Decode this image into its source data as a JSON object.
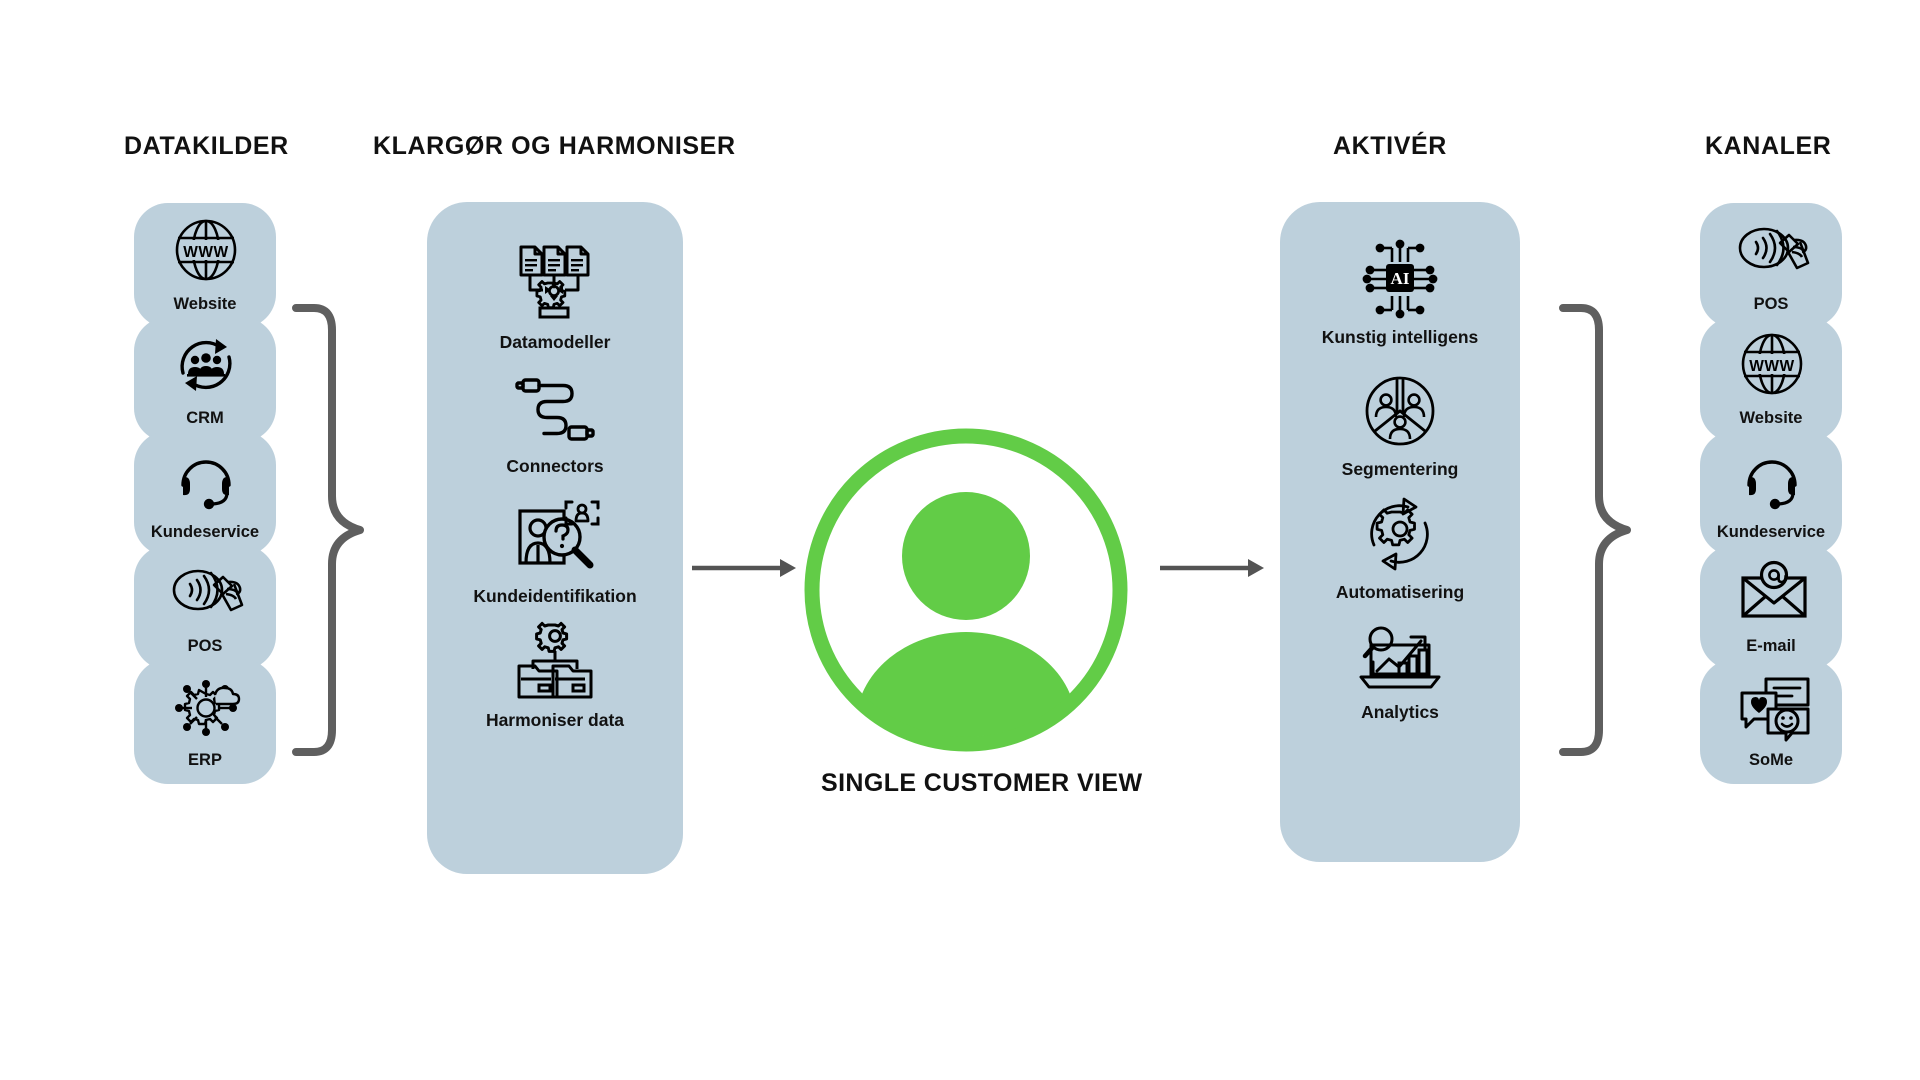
{
  "diagram": {
    "title": "SINGLE CUSTOMER VIEW",
    "colors": {
      "panel": "#bdd0dc",
      "accent_green": "#62cc47",
      "brace": "#5f5f5f",
      "arrow": "#545454",
      "text": "#111111"
    }
  },
  "columns": {
    "datakilder": {
      "header": "DATAKILDER",
      "items": [
        {
          "label": "Website",
          "icon": "globe-www-icon"
        },
        {
          "label": "CRM",
          "icon": "crm-people-cycle-icon"
        },
        {
          "label": "Kundeservice",
          "icon": "headset-icon"
        },
        {
          "label": "POS",
          "icon": "contactless-payment-icon"
        },
        {
          "label": "ERP",
          "icon": "erp-gear-network-cloud-icon"
        }
      ]
    },
    "klargor": {
      "header": "KLARGØR OG HARMONISER",
      "items": [
        {
          "label": "Datamodeller",
          "icon": "documents-to-gear-icon"
        },
        {
          "label": "Connectors",
          "icon": "cable-connector-icon"
        },
        {
          "label": "Kundeidentifikation",
          "icon": "person-magnifier-question-icon"
        },
        {
          "label": "Harmoniser data",
          "icon": "gear-two-folders-icon"
        }
      ]
    },
    "aktiver": {
      "header": "AKTIVÉR",
      "items": [
        {
          "label": "Kunstig intelligens",
          "icon": "ai-chip-icon"
        },
        {
          "label": "Segmentering",
          "icon": "segmented-pie-people-icon"
        },
        {
          "label": "Automatisering",
          "icon": "gear-refresh-cycle-icon"
        },
        {
          "label": "Analytics",
          "icon": "laptop-chart-magnifier-icon"
        }
      ]
    },
    "kanaler": {
      "header": "KANALER",
      "items": [
        {
          "label": "POS",
          "icon": "contactless-payment-icon"
        },
        {
          "label": "Website",
          "icon": "globe-www-icon"
        },
        {
          "label": "Kundeservice",
          "icon": "headset-icon"
        },
        {
          "label": "E-mail",
          "icon": "envelope-at-icon"
        },
        {
          "label": "SoMe",
          "icon": "chat-bubbles-social-icon"
        }
      ]
    }
  },
  "center": {
    "label": "SINGLE CUSTOMER VIEW",
    "icon": "user-avatar-circle-icon"
  },
  "connectors": {
    "left_brace": "curly-brace-right-icon",
    "right_brace": "curly-brace-right-icon",
    "arrow_in": "arrow-right-icon",
    "arrow_out": "arrow-right-icon"
  }
}
